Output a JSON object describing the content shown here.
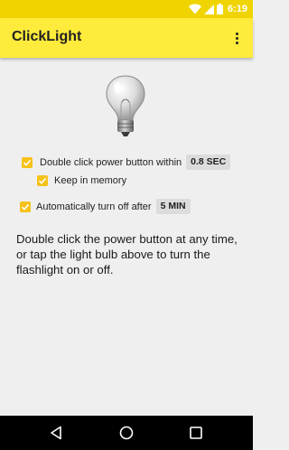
{
  "status_bar": {
    "time": "6:19",
    "icons": [
      "wifi-icon",
      "cell-signal-icon",
      "battery-icon"
    ]
  },
  "app_bar": {
    "title": "ClickLight",
    "menu_icon": "overflow-menu-icon"
  },
  "main": {
    "bulb_icon": "light-bulb-icon",
    "settings": {
      "double_click": {
        "label": "Double click power button within",
        "value": "0.8 SEC",
        "checked": true
      },
      "keep_in_memory": {
        "label": "Keep in memory",
        "checked": true
      },
      "auto_off": {
        "label": "Automatically turn off after",
        "value": "5 MIN",
        "checked": true
      }
    },
    "description": "Double click the power button at any time, or tap the light bulb above to turn the flashlight on or off."
  },
  "nav_bar": {
    "back_icon": "back-icon",
    "home_icon": "home-icon",
    "recents_icon": "recents-icon"
  },
  "colors": {
    "status_bar": "#f0d400",
    "app_bar": "#ffeb3b",
    "checkbox": "#f6c21a",
    "background": "#efefef"
  }
}
